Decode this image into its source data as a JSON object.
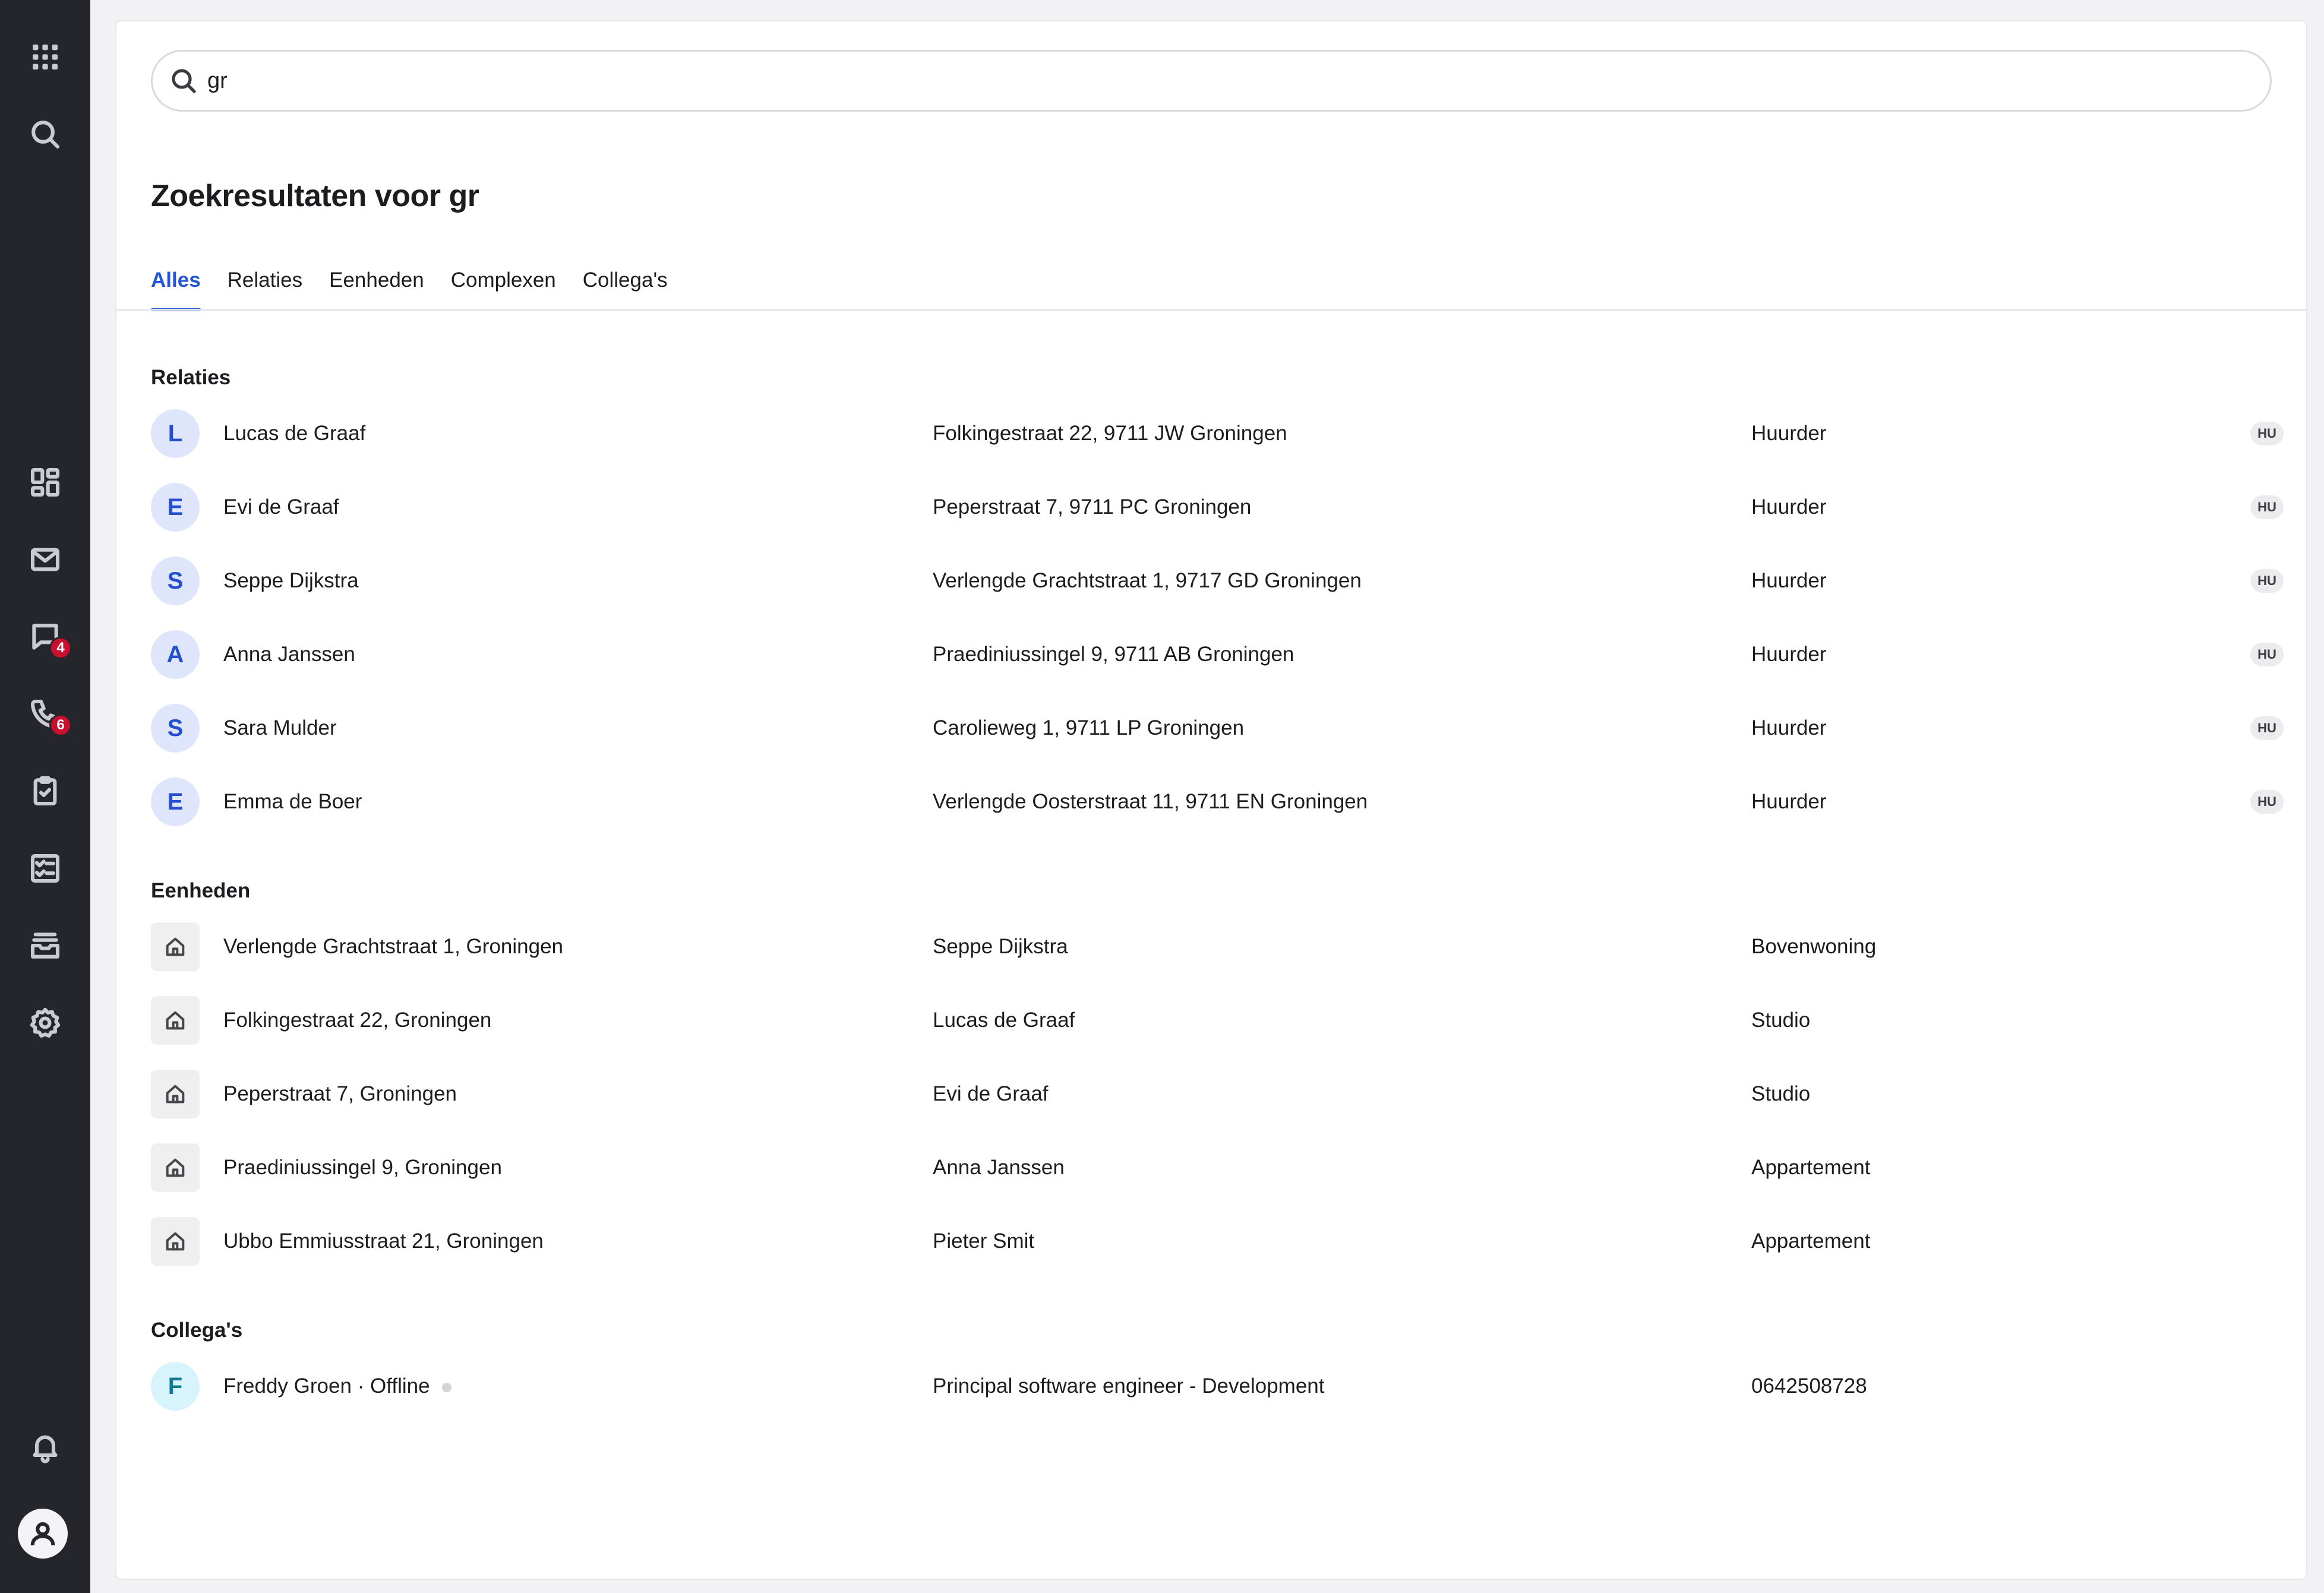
{
  "sidebar": {
    "icons": [
      "apps-grid-icon",
      "search-icon",
      "dashboard-icon",
      "mail-icon",
      "chat-icon",
      "phone-icon",
      "clipboard-icon",
      "checklist-icon",
      "inbox-icon",
      "settings-icon",
      "bell-icon",
      "user-avatar-icon"
    ],
    "chat_badge": "4",
    "phone_badge": "6"
  },
  "search": {
    "value": "gr"
  },
  "page": {
    "title": "Zoekresultaten voor gr"
  },
  "tabs": [
    {
      "label": "Alles",
      "active": true
    },
    {
      "label": "Relaties",
      "active": false
    },
    {
      "label": "Eenheden",
      "active": false
    },
    {
      "label": "Complexen",
      "active": false
    },
    {
      "label": "Collega's",
      "active": false
    }
  ],
  "relaties": {
    "title": "Relaties",
    "rows": [
      {
        "initial": "L",
        "name": "Lucas de Graaf",
        "address": "Folkingestraat 22, 9711 JW Groningen",
        "role": "Huurder",
        "tag": "HU"
      },
      {
        "initial": "E",
        "name": "Evi de Graaf",
        "address": "Peperstraat 7, 9711 PC Groningen",
        "role": "Huurder",
        "tag": "HU"
      },
      {
        "initial": "S",
        "name": "Seppe Dijkstra",
        "address": "Verlengde Grachtstraat 1, 9717 GD Groningen",
        "role": "Huurder",
        "tag": "HU"
      },
      {
        "initial": "A",
        "name": "Anna Janssen",
        "address": "Praediniussingel 9, 9711 AB Groningen",
        "role": "Huurder",
        "tag": "HU"
      },
      {
        "initial": "S",
        "name": "Sara Mulder",
        "address": "Carolieweg 1, 9711 LP Groningen",
        "role": "Huurder",
        "tag": "HU"
      },
      {
        "initial": "E",
        "name": "Emma de Boer",
        "address": "Verlengde Oosterstraat 11, 9711 EN Groningen",
        "role": "Huurder",
        "tag": "HU"
      }
    ]
  },
  "eenheden": {
    "title": "Eenheden",
    "rows": [
      {
        "address": "Verlengde Grachtstraat 1, Groningen",
        "tenant": "Seppe Dijkstra",
        "type": "Bovenwoning"
      },
      {
        "address": "Folkingestraat 22, Groningen",
        "tenant": "Lucas de Graaf",
        "type": "Studio"
      },
      {
        "address": "Peperstraat 7, Groningen",
        "tenant": "Evi de Graaf",
        "type": "Studio"
      },
      {
        "address": "Praediniussingel 9, Groningen",
        "tenant": "Anna Janssen",
        "type": "Appartement"
      },
      {
        "address": "Ubbo Emmiusstraat 21, Groningen",
        "tenant": "Pieter Smit",
        "type": "Appartement"
      }
    ]
  },
  "collegas": {
    "title": "Collega's",
    "rows": [
      {
        "initial": "F",
        "name": "Freddy Groen · Offline",
        "function": "Principal software engineer - Development",
        "phone": "0642508728"
      }
    ]
  }
}
